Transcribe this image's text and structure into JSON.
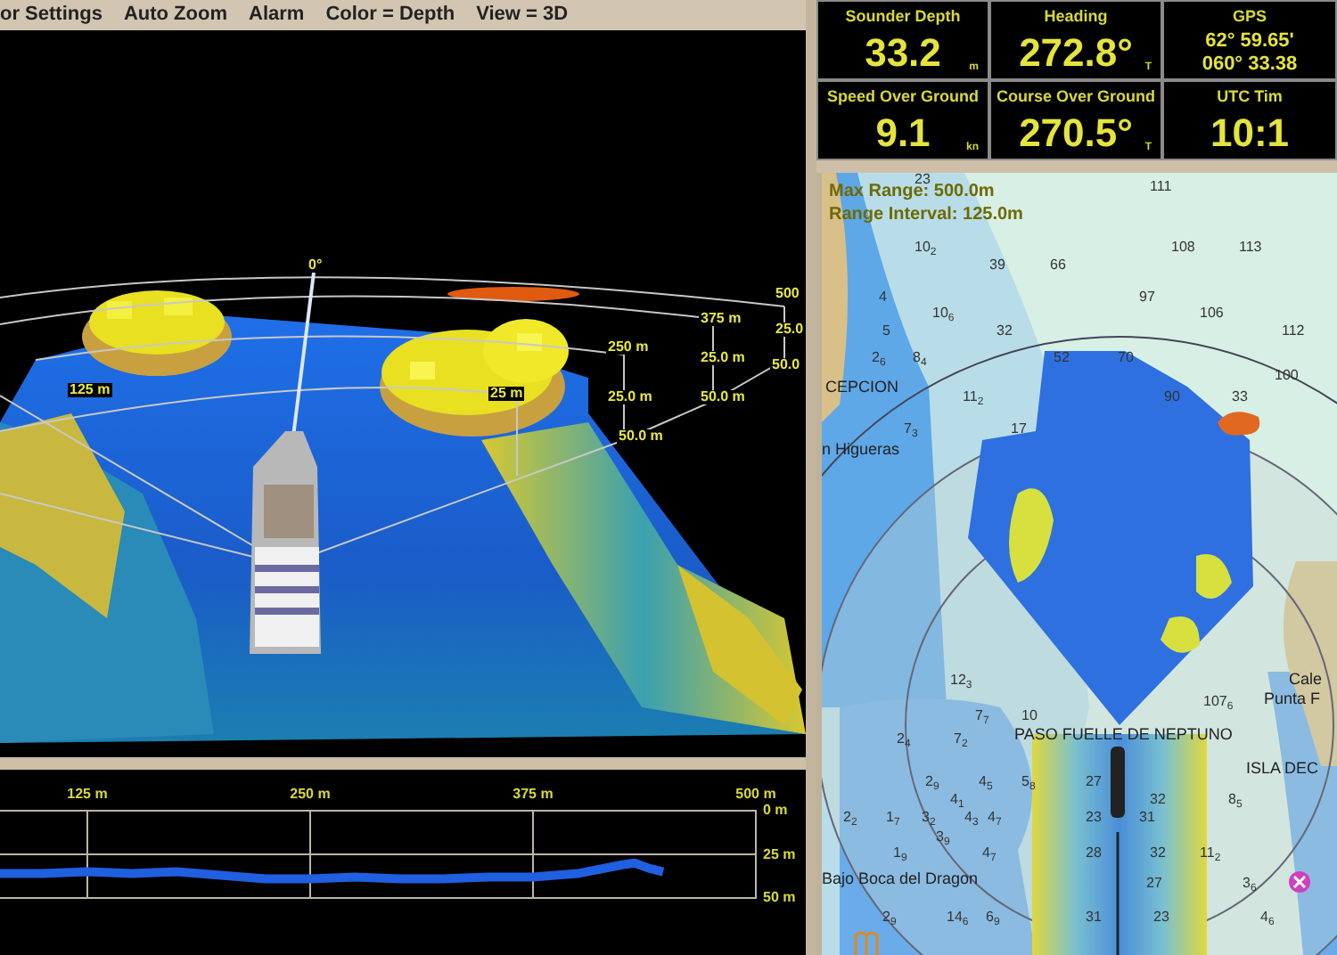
{
  "menu": [
    "or Settings",
    "Auto Zoom",
    "Alarm",
    "Color = Depth",
    "View = 3D"
  ],
  "view_3d": {
    "labels": [
      "0°",
      "500",
      "375 m",
      "25.0",
      "250 m",
      "25.0 m",
      "50.0",
      "125 m",
      "25 m",
      "25.0 m",
      "50.0 m",
      "50.0 m"
    ]
  },
  "profile": {
    "chart_data": {
      "type": "line",
      "x": [
        76,
        100,
        125,
        150,
        175,
        200,
        225,
        250,
        275,
        300,
        325,
        350,
        375,
        400,
        425,
        432,
        440,
        448
      ],
      "series": [
        {
          "color": "#1f5fe0",
          "values": [
            36,
            36,
            35,
            36,
            35,
            37,
            39,
            39,
            38,
            39,
            39,
            38,
            38,
            36,
            31,
            30,
            33,
            35
          ]
        }
      ],
      "xlim": [
        76,
        500
      ],
      "ylim": [
        50,
        0
      ],
      "grid": true,
      "xticks": [
        {
          "value": 125,
          "label": "125 m"
        },
        {
          "value": 250,
          "label": "250 m"
        },
        {
          "value": 375,
          "label": "375 m"
        },
        {
          "value": 500,
          "label": "500 m"
        }
      ],
      "yticks": [
        {
          "value": 0,
          "label": "0 m"
        },
        {
          "value": 25,
          "label": "25 m"
        },
        {
          "value": 50,
          "label": "50 m"
        }
      ]
    }
  },
  "instruments": [
    {
      "kind": "single",
      "title": "Sounder Depth",
      "value": "33.2",
      "unit": "m"
    },
    {
      "kind": "single",
      "title": "Heading",
      "value": "272.8°",
      "unit": "T"
    },
    {
      "kind": "dual",
      "title": "GPS",
      "lines": [
        "62° 59.65'",
        "060° 33.38"
      ]
    },
    {
      "kind": "single",
      "title": "Speed Over Ground",
      "value": "9.1",
      "unit": "kn"
    },
    {
      "kind": "single",
      "title": "Course Over Ground",
      "value": "270.5°",
      "unit": "T"
    },
    {
      "kind": "single",
      "title": "UTC Tim",
      "value": "10:1"
    }
  ],
  "map": {
    "overlay": [
      "Max Range: 500.0m",
      "Range Interval: 125.0m"
    ],
    "place_names": [
      "CEPCION",
      "n Higueras",
      "Cale",
      "Punta F",
      "ISLA DEC",
      "PASO FUELLE DE NEPTUNO",
      "Bajo Boca del Dragon"
    ],
    "soundings": [
      "23",
      "111",
      "10$_{2}$",
      "108",
      "113",
      "39",
      "66",
      "4",
      "97",
      "10$_{6}$",
      "106",
      "5",
      "32",
      "112",
      "2$_{6}$",
      "8$_{4}$",
      "52",
      "70",
      "100",
      "11$_{2}$",
      "90",
      "33",
      "7$_{3}$",
      "17",
      "12$_{3}$",
      "107$_{6}$",
      "7$_{7}$",
      "10",
      "2$_{4}$",
      "7$_{2}$",
      "2$_{9}$",
      "4$_{5}$",
      "5$_{8}$",
      "27",
      "4$_{1}$",
      "32",
      "8$_{5}$",
      "2$_{2}$",
      "1$_{7}$",
      "3$_{2}$",
      "4$_{3}$",
      "4$_{7}$",
      "23",
      "31",
      "3$_{9}$",
      "1$_{9}$",
      "4$_{7}$",
      "28",
      "32",
      "11$_{2}$",
      "27",
      "3$_{6}$",
      "2$_{9}$",
      "14$_{6}$",
      "6$_{9}$",
      "31",
      "23",
      "4$_{6}$"
    ]
  }
}
